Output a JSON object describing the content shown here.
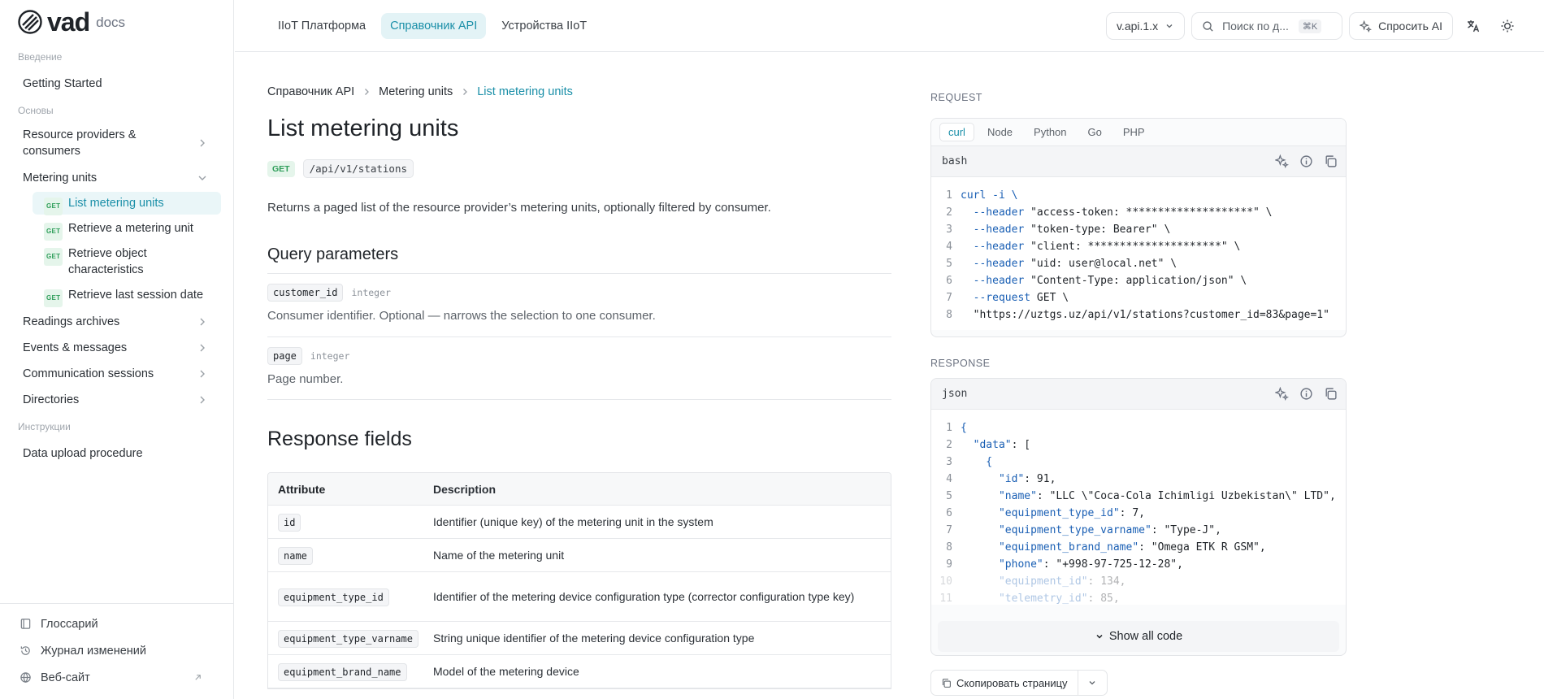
{
  "logo": {
    "word": "vad",
    "suffix": "docs"
  },
  "sidebar": {
    "sections": [
      {
        "title": "Введение",
        "items": [
          {
            "label": "Getting Started"
          }
        ]
      },
      {
        "title": "Основы"
      },
      {
        "title": "Инструкции",
        "items": [
          {
            "label": "Data upload procedure"
          }
        ]
      }
    ],
    "resource_providers": "Resource providers &",
    "resource_providers_2": "consumers",
    "metering_units": "Metering units",
    "subitems": [
      {
        "badge": "GET",
        "label": "List metering units"
      },
      {
        "badge": "GET",
        "label": "Retrieve a metering unit"
      },
      {
        "badge": "GET",
        "label": "Retrieve object",
        "label2": "characteristics"
      },
      {
        "badge": "GET",
        "label": "Retrieve last session date"
      }
    ],
    "readings_archives": "Readings archives",
    "events_messages": "Events & messages",
    "communication_sessions": "Communication sessions",
    "directories": "Directories",
    "footer": [
      {
        "label": "Глоссарий"
      },
      {
        "label": "Журнал изменений"
      },
      {
        "label": "Веб-сайт"
      }
    ]
  },
  "topbar": {
    "tabs": [
      {
        "label": "IIoT Платформа"
      },
      {
        "label": "Справочник API"
      },
      {
        "label": "Устройства IIoT"
      }
    ],
    "version": "v.api.1.x",
    "search_placeholder": "Поиск по д...",
    "search_kbd": "⌘K",
    "ask_ai": "Спросить AI"
  },
  "main": {
    "breadcrumb": [
      "Справочник API",
      "Metering units",
      "List metering units"
    ],
    "title": "List metering units",
    "method": "GET",
    "path": "/api/v1/stations",
    "description": "Returns a paged list of the resource provider’s metering units, optionally filtered by consumer.",
    "query_title": "Query parameters",
    "params": [
      {
        "name": "customer_id",
        "type": "integer",
        "desc": "Consumer identifier. Optional — narrows the selection to one consumer."
      },
      {
        "name": "page",
        "type": "integer",
        "desc": "Page number."
      }
    ],
    "response_title": "Response fields",
    "table": {
      "headers": [
        "Attribute",
        "Description"
      ],
      "rows": [
        {
          "attr": "id",
          "desc": "Identifier (unique key) of the metering unit in the system"
        },
        {
          "attr": "name",
          "desc": "Name of the metering unit"
        },
        {
          "attr": "equipment_type_id",
          "desc": "Identifier of the metering device configuration type (corrector configuration type key)"
        },
        {
          "attr": "equipment_type_varname",
          "desc": "String unique identifier of the metering device configuration type"
        },
        {
          "attr": "equipment_brand_name",
          "desc": "Model of the metering device"
        }
      ]
    }
  },
  "request": {
    "label": "REQUEST",
    "tabs": [
      "curl",
      "Node",
      "Python",
      "Go",
      "PHP"
    ],
    "lang": "bash",
    "lines": [
      [
        "curl -i \\",
        ""
      ],
      [
        "  --header ",
        "\"access-token: ********************\" \\"
      ],
      [
        "  --header ",
        "\"token-type: Bearer\" \\"
      ],
      [
        "  --header ",
        "\"client: *********************\" \\"
      ],
      [
        "  --header ",
        "\"uid: user@local.net\" \\"
      ],
      [
        "  --header ",
        "\"Content-Type: application/json\" \\"
      ],
      [
        "  --request ",
        "GET \\"
      ],
      [
        "  ",
        "\"https://uztgs.uz/api/v1/stations?customer_id=83&page=1\""
      ]
    ]
  },
  "response": {
    "label": "RESPONSE",
    "lang": "json",
    "lines": [
      [
        "{",
        ""
      ],
      [
        "  \"data\"",
        ": ["
      ],
      [
        "    {",
        ""
      ],
      [
        "      \"id\"",
        ": 91,"
      ],
      [
        "      \"name\"",
        ": \"LLC \\\"Coca-Cola Ichimligi Uzbekistan\\\" LTD\","
      ],
      [
        "      \"equipment_type_id\"",
        ": 7,"
      ],
      [
        "      \"equipment_type_varname\"",
        ": \"Type-J\","
      ],
      [
        "      \"equipment_brand_name\"",
        ": \"Omega ETK R GSM\","
      ],
      [
        "      \"phone\"",
        ": \"+998-97-725-12-28\","
      ],
      [
        "      \"equipment_id\"",
        ": 134,"
      ],
      [
        "      \"telemetry_id\"",
        ": 85,"
      ]
    ],
    "show_all": "Show all code"
  },
  "copy_page": "Скопировать страницу",
  "colors": {
    "accent": "#1a8fa8",
    "get": "#2f9e5a"
  }
}
